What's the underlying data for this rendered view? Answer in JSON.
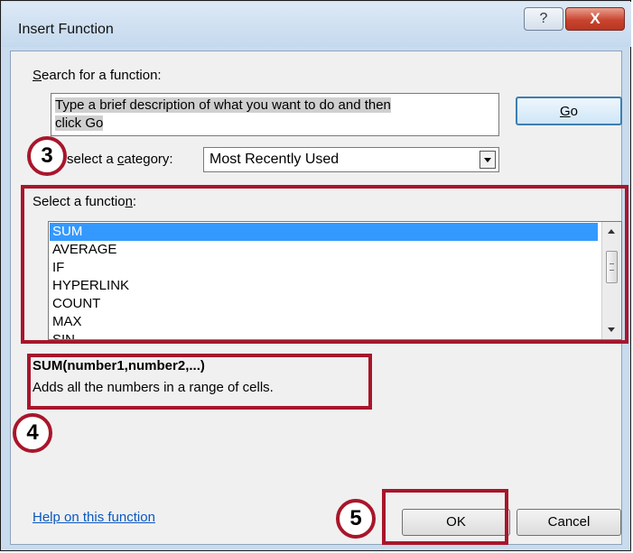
{
  "window": {
    "title": "Insert Function",
    "help_glyph": "?",
    "close_glyph": "X"
  },
  "search": {
    "label_pre": "",
    "label_accel": "S",
    "label_post": "earch for a function:",
    "text_line1": "Type a brief description of what you want to do and then",
    "text_line2": "click Go",
    "go_accel": "G",
    "go_rest": "o"
  },
  "category": {
    "label_pre": "select a ",
    "label_accel": "c",
    "label_post": "ategory:",
    "value": "Most Recently Used"
  },
  "function_list": {
    "label_pre": "Select a functio",
    "label_accel": "n",
    "label_post": ":",
    "items": [
      "SUM",
      "AVERAGE",
      "IF",
      "HYPERLINK",
      "COUNT",
      "MAX",
      "SIN"
    ],
    "selected": "SUM"
  },
  "details": {
    "signature": "SUM(number1,number2,...)",
    "description": "Adds all the numbers in a range of cells."
  },
  "footer": {
    "help_link": "Help on this function",
    "ok_label": "OK",
    "cancel_label": "Cancel"
  },
  "callouts": [
    "3",
    "4",
    "5"
  ],
  "colors": {
    "callout": "#a8162b",
    "selection": "#3399ff",
    "link": "#0a58c0",
    "close_button": "#c9452f"
  }
}
